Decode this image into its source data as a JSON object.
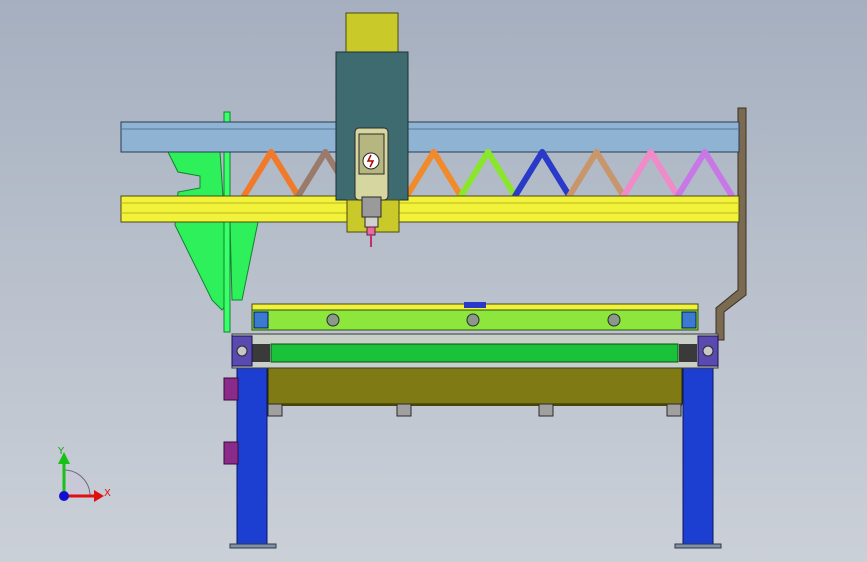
{
  "triad": {
    "y_label": "Y",
    "x_label": "X"
  },
  "colors": {
    "spindle_top": "#c9c92a",
    "spindle_body": "#3d6b70",
    "beam_top": "#8fb3d3",
    "beam_bottom": "#f2f23a",
    "bracket": "#2ef05a",
    "bed_top": "#8ce63c",
    "bed_mid": "#19c239",
    "bed_lower": "#7f7a13",
    "legs": "#1d3fd1",
    "right_post": "#7a6a52",
    "truss": [
      "#f07a2a",
      "#9a7a6a",
      "#8a4ad0",
      "#f08a2a",
      "#8ae62a",
      "#2a3ac8",
      "#c8966a",
      "#f08ac8",
      "#c878e6"
    ]
  }
}
